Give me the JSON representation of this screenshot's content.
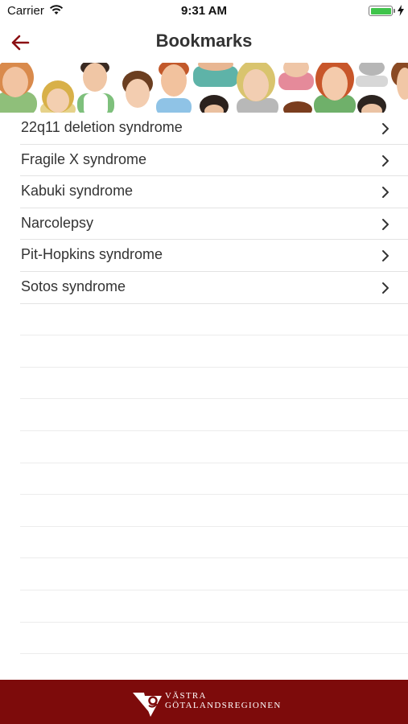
{
  "status_bar": {
    "carrier": "Carrier",
    "time": "9:31 AM",
    "battery_color": "#3fc44b"
  },
  "nav": {
    "title": "Bookmarks",
    "back_icon": "arrow-left-icon",
    "accent_color": "#8b0f12"
  },
  "bookmarks": [
    {
      "label": "22q11 deletion syndrome"
    },
    {
      "label": "Fragile X syndrome"
    },
    {
      "label": "Kabuki syndrome"
    },
    {
      "label": "Narcolepsy"
    },
    {
      "label": "Pit-Hopkins syndrome"
    },
    {
      "label": "Sotos syndrome"
    }
  ],
  "footer": {
    "line1": "VÄSTRA",
    "line2": "GÖTALANDSREGIONEN",
    "background_color": "#7d0b0b"
  }
}
